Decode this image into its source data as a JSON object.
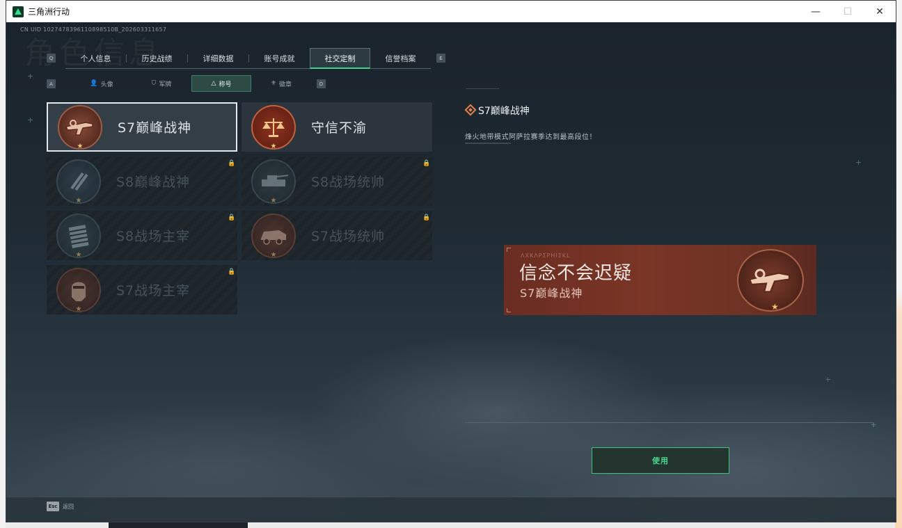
{
  "window": {
    "title": "三角洲行动",
    "minimize": "—",
    "maximize": "☐",
    "close": "✕"
  },
  "uid": "CN UID 1027478396110898510B_202603311657",
  "background_title": "角色信息",
  "keys": {
    "prev_tab": "Q",
    "next_tab": "E",
    "prev_sub": "A",
    "next_sub": "D",
    "esc": "Esc"
  },
  "tabs": [
    {
      "label": "个人信息",
      "active": false
    },
    {
      "label": "历史战绩",
      "active": false
    },
    {
      "label": "详细数据",
      "active": false
    },
    {
      "label": "账号成就",
      "active": false
    },
    {
      "label": "社交定制",
      "active": true
    },
    {
      "label": "信誉档案",
      "active": false
    }
  ],
  "subtabs": [
    {
      "label": "头像",
      "icon": "person-icon",
      "glyph": "👤"
    },
    {
      "label": "军牌",
      "icon": "shield-icon",
      "glyph": "⛉"
    },
    {
      "label": "称号",
      "icon": "triangle-icon",
      "glyph": "△"
    },
    {
      "label": "徽章",
      "icon": "emblem-icon",
      "glyph": "⚜"
    }
  ],
  "cards": [
    {
      "name": "S7巅峰战神",
      "medal": "rifle-medal",
      "locked": false,
      "selected": true
    },
    {
      "name": "守信不渝",
      "medal": "scales-medal",
      "locked": false,
      "selected": false
    },
    {
      "name": "S8巅峰战神",
      "medal": "stripes-medal",
      "locked": true,
      "selected": false
    },
    {
      "name": "S8战场统帅",
      "medal": "tank-medal",
      "locked": true,
      "selected": false
    },
    {
      "name": "S8战场主宰",
      "medal": "tower-medal",
      "locked": true,
      "selected": false
    },
    {
      "name": "S7战场统帅",
      "medal": "apc-medal",
      "locked": true,
      "selected": false
    },
    {
      "name": "S7战场主宰",
      "medal": "helmet-medal",
      "locked": true,
      "selected": false
    }
  ],
  "detail": {
    "title": "S7巅峰战神",
    "description": "烽火地带模式阿萨拉赛季达到最高段位！",
    "banner_main": "信念不会迟疑",
    "banner_sub": "S7巅峰战神",
    "banner_code": "ΛΧΚΛΡΣΡΗΙΣΚL",
    "star": "★"
  },
  "actions": {
    "use": "使用",
    "back": "返回"
  },
  "colors": {
    "accent_green": "#43d18c",
    "banner_red": "#7a3526",
    "medal_bronze": "#b8745a"
  }
}
